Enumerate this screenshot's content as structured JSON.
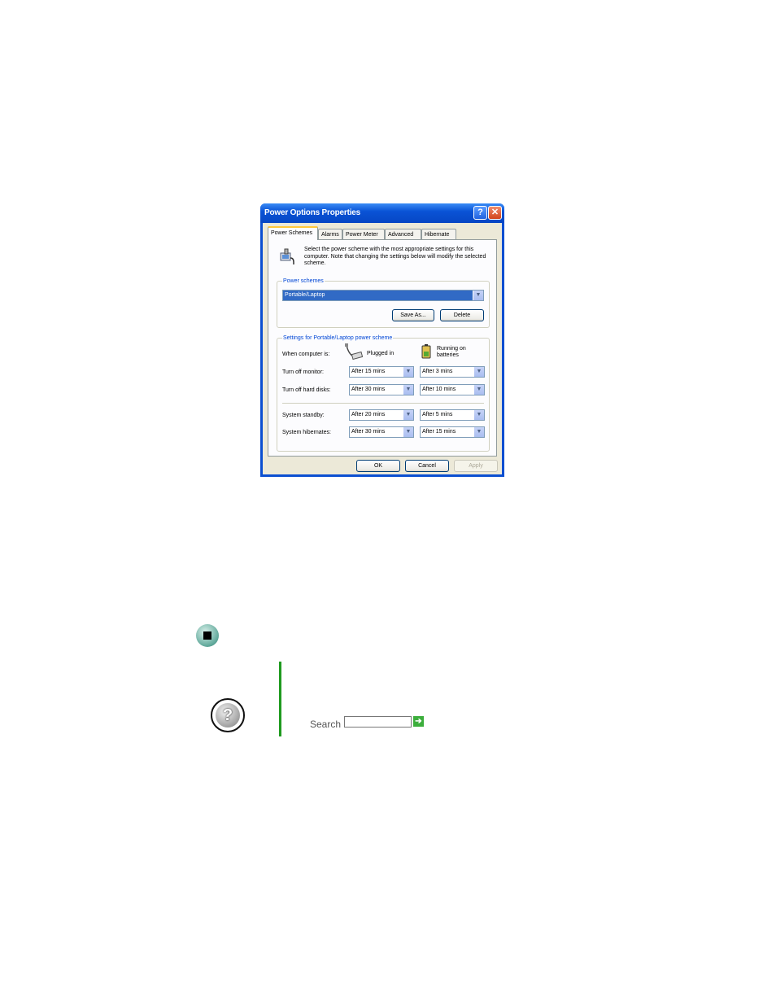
{
  "window": {
    "title": "Power Options Properties"
  },
  "titlebar_buttons": {
    "help": "?",
    "close": "✕"
  },
  "tabs": [
    {
      "label": "Power Schemes",
      "active": true
    },
    {
      "label": "Alarms"
    },
    {
      "label": "Power Meter"
    },
    {
      "label": "Advanced"
    },
    {
      "label": "Hibernate"
    }
  ],
  "intro_text": "Select the power scheme with the most appropriate settings for this computer. Note that changing the settings below will modify the selected scheme.",
  "power_schemes": {
    "group_label": "Power schemes",
    "selected": "Portable/Laptop",
    "save_as_label": "Save As...",
    "delete_label": "Delete"
  },
  "settings": {
    "group_label": "Settings for Portable/Laptop power scheme",
    "when_label": "When computer is:",
    "plugged_in_label": "Plugged in",
    "batteries_label_1": "Running on",
    "batteries_label_2": "batteries",
    "rows": [
      {
        "label": "Turn off monitor:",
        "plugged": "After 15 mins",
        "battery": "After 3 mins"
      },
      {
        "label": "Turn off hard disks:",
        "plugged": "After 30 mins",
        "battery": "After 10 mins"
      },
      {
        "label": "System standby:",
        "plugged": "After 20 mins",
        "battery": "After 5 mins"
      },
      {
        "label": "System hibernates:",
        "plugged": "After 30 mins",
        "battery": "After 15 mins"
      }
    ]
  },
  "footer": {
    "ok_label": "OK",
    "cancel_label": "Cancel",
    "apply_label": "Apply"
  },
  "help_box": {
    "search_label": "Search",
    "search_value": "",
    "go_symbol": "➔"
  },
  "icons": {
    "dropdown": "▼"
  }
}
